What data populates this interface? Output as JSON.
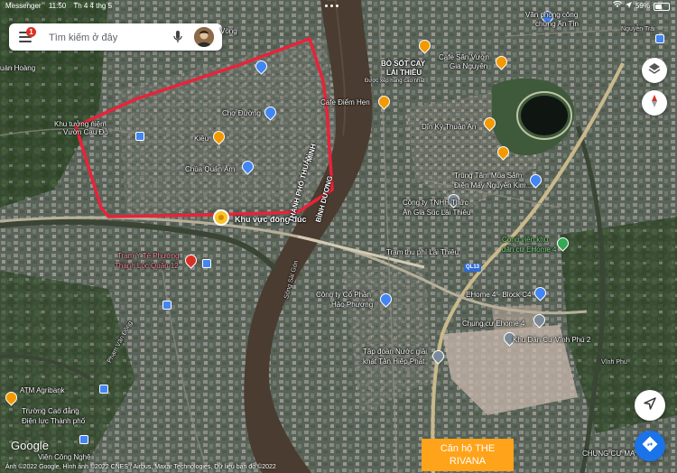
{
  "status_bar": {
    "app": "Messenger",
    "time": "11:50",
    "date": "Th 4 4 thg 5",
    "battery": "59%",
    "battery_level": 0.59
  },
  "search": {
    "placeholder": "Tìm kiếm ở đây",
    "notification_count": "1"
  },
  "controls": {
    "layers_icon": "layers-icon",
    "compass_icon": "compass-icon",
    "location_icon": "my-location-icon",
    "directions_icon": "directions-icon"
  },
  "labels": {
    "vong": "Vòng",
    "quan_hoang": "uán Hoàng",
    "khu_tuong_niem_1": "Khu tưởng niệm",
    "khu_tuong_niem_2": "Vườn Cau Đỏ",
    "cho_duong": "Chợ Đường",
    "kieu": "Kiều",
    "chua_quan_am": "Chùa Quán Âm",
    "khu_vuc_dong_duc": "Khu vực đông đúc",
    "tram_y_te_1": "Trạm Y Tế Phường",
    "tram_y_te_2": "Thạnh Lộc Quận 12",
    "cafe_diem_hen": "Cafe Điểm Hẹn",
    "thanh_pho_thu": "THÀNH PHỐ THUẬN",
    "minh": "MINH",
    "binh_duong": "BÌNH DƯƠNG",
    "bo_sot_cay_1": "BÒ SỐT CAY",
    "bo_sot_cay_2": "LÁI THIÊU",
    "bo_sot_cay_3": "Được xếp hạng cao nhất",
    "cafe_san_vuon_1": "Cafe Sân Vườn",
    "cafe_san_vuon_2": "Gia Nguyên",
    "van_phong_cong_1": "Văn phòng công",
    "van_phong_cong_2": "chứng An Tín",
    "nguyen_trai": "Nguyễn Trãi",
    "din_ky": "Dĩn Ký Thuận An",
    "trung_tam_1": "Trung Tâm Mua Sắm",
    "trung_tam_2": "Điện Máy Nguyễn Kim...",
    "cong_ty_thuc_an_1": "Công ty TNHH Thức",
    "cong_ty_thuc_an_2": "Ăn Gia Súc Lái Thiêu",
    "tram_thu_phi": "Trạm thu phí Lái Thiêu",
    "ql13": "QL13",
    "cong_vien_1": "Công viên khu",
    "cong_vien_2": "dân cư EHome 4",
    "ehome4_block": "EHome 4 - Block C4",
    "song_sai_gon": "Sông Sài Gòn",
    "cong_ty_hao_1": "Công ty Cổ Phần",
    "cong_ty_hao_2": "Hảo Phương",
    "chung_cu_ehome": "Chung cư Ehome 4",
    "khu_dan_cu": "Khu Dân Cư Vĩnh Phú 2",
    "tap_doan_1": "Tập đoàn Nước giải",
    "tap_doan_2": "khát Tân Hiệp Phát",
    "atm": "ATM Agribank",
    "truong_cd_1": "Trường Cao đẳng",
    "truong_cd_2": "Điện lực Thành phố",
    "vien_cong_nghe": "Viện Công Nghệ",
    "chung_cu_ma": "CHUNG CƯ MA",
    "pham_van_dong": "Phạm Văn Đồng",
    "vinh_phu": "Vĩnh Phú"
  },
  "overlay_box": {
    "line1": "Căn hộ THE",
    "line2": "RIVANA"
  },
  "footer": {
    "logo": "Google",
    "copyright": "Ảnh ©2022 Google, Hình ảnh ©2022 CNES / Airbus, Maxar Technologies, Dữ liệu bản đồ ©2022"
  },
  "colors": {
    "river": "#4a3c31",
    "highlight": "#e8233a",
    "overlay": "#ffa31a",
    "road": "#c9b98b"
  }
}
